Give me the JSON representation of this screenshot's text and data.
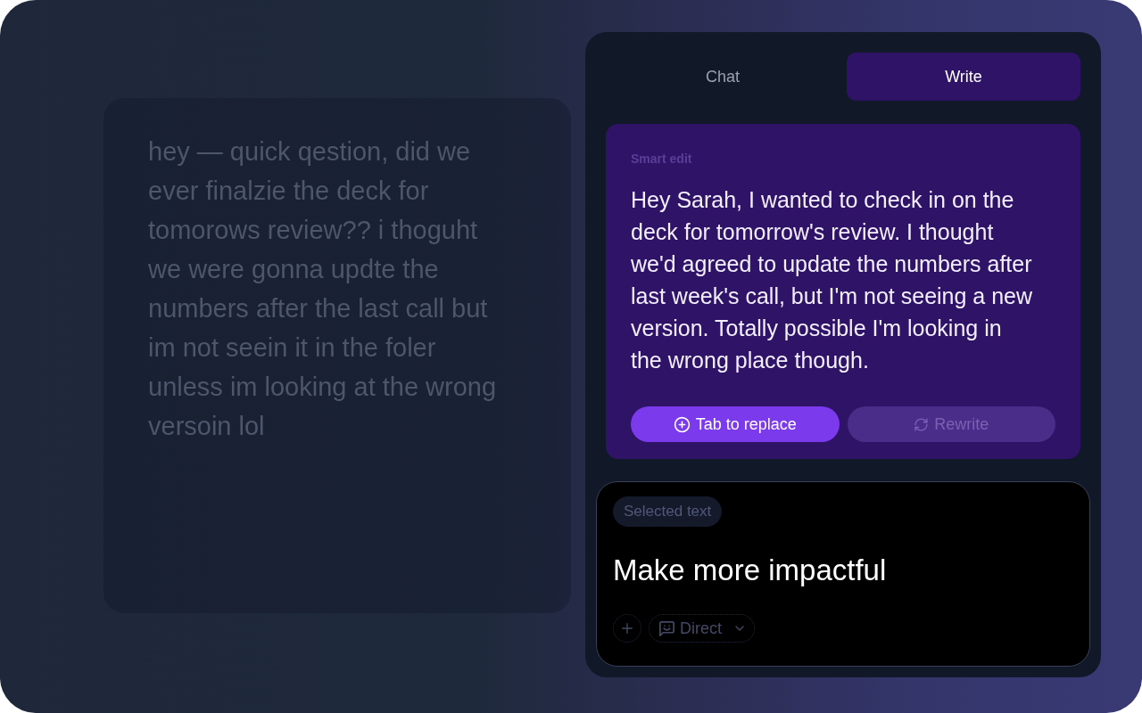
{
  "draft": {
    "text": "hey — quick qestion, did we ever finalzie the deck for tomorows review?? i thoguht we were gonna updte the numbers after the last call but im not seein it in the foler unless im looking at the wrong versoin lol"
  },
  "tabs": [
    {
      "label": "Chat",
      "selected": false
    },
    {
      "label": "Write",
      "selected": true
    }
  ],
  "smart_edit": {
    "label": "Smart edit",
    "text": "Hey Sarah, I wanted to check in on the deck for tomorrow's review. I thought we'd agreed to update the numbers after last week's call, but I'm not seeing a new version. Totally possible I'm looking in the wrong place though.",
    "actions": [
      {
        "label": "Tab to replace",
        "kind": "replace",
        "disabled": false
      },
      {
        "label": "Rewrite",
        "kind": "rewrite",
        "disabled": true
      }
    ]
  },
  "composer": {
    "chip": "Selected text",
    "prompt": "Make more impactful",
    "mode": {
      "label": "Direct"
    }
  }
}
